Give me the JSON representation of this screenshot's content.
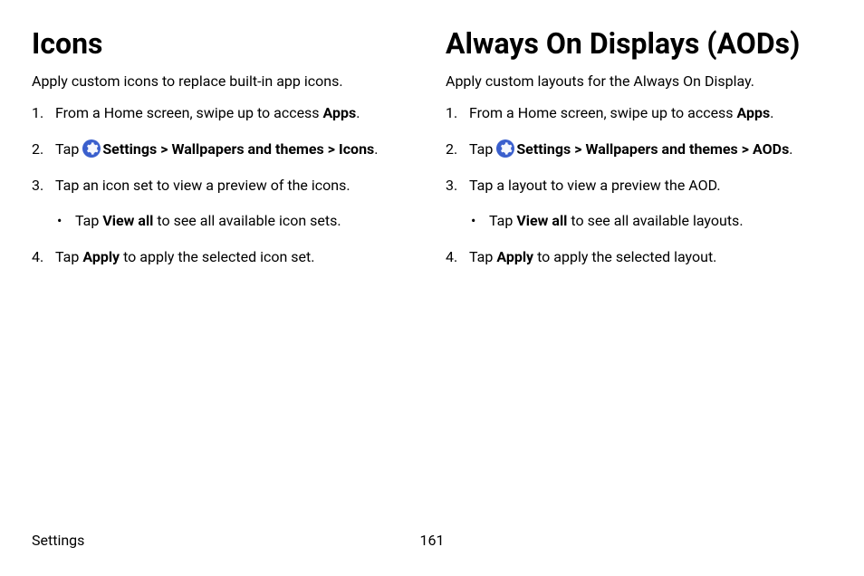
{
  "left": {
    "heading": "Icons",
    "intro": "Apply custom icons to replace built-in app icons.",
    "step1_pre": "From a Home screen, swipe up to access ",
    "step1_bold": "Apps",
    "step1_post": ".",
    "step2_pre": "Tap ",
    "step2_settings": "Settings",
    "step2_wall": "Wallpapers and themes",
    "step2_icons": "Icons",
    "step2_post": ".",
    "step3": "Tap an icon set to view a preview of the icons.",
    "step3_bullet_pre": "Tap ",
    "step3_bullet_bold": "View all",
    "step3_bullet_post": " to see all available icon sets.",
    "step4_pre": "Tap ",
    "step4_bold": "Apply",
    "step4_post": " to apply the selected icon set."
  },
  "right": {
    "heading": "Always On Displays (AODs)",
    "intro": "Apply custom layouts for the Always On Display.",
    "step1_pre": "From a Home screen, swipe up to access ",
    "step1_bold": "Apps",
    "step1_post": ".",
    "step2_pre": "Tap ",
    "step2_settings": "Settings",
    "step2_wall": "Wallpapers and themes",
    "step2_aods": "AODs",
    "step2_post": ".",
    "step3": "Tap a layout to view a preview the AOD.",
    "step3_bullet_pre": "Tap ",
    "step3_bullet_bold": "View all",
    "step3_bullet_post": " to see all available layouts.",
    "step4_pre": "Tap ",
    "step4_bold": "Apply",
    "step4_post": " to apply the selected layout."
  },
  "footer": {
    "section": "Settings",
    "page": "161"
  },
  "glyphs": {
    "chevron": ">"
  }
}
